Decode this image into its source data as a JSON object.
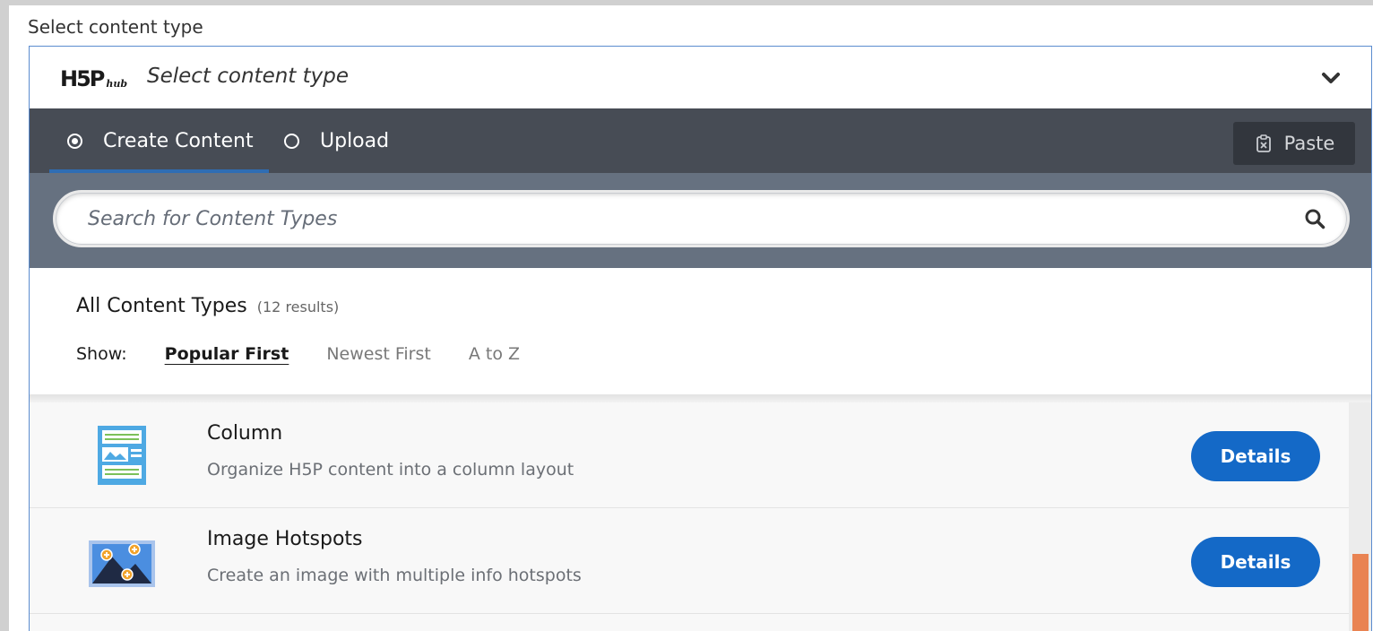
{
  "field_label": "Select content type",
  "header": {
    "logo_main": "H5P",
    "logo_sub": "hub",
    "title": "Select content type"
  },
  "tabs": [
    {
      "label": "Create Content",
      "selected": true
    },
    {
      "label": "Upload",
      "selected": false
    }
  ],
  "paste_button": {
    "label": "Paste"
  },
  "search": {
    "placeholder": "Search for Content Types"
  },
  "results": {
    "title": "All Content Types",
    "count": "(12 results)"
  },
  "sort": {
    "label": "Show:",
    "options": [
      "Popular First",
      "Newest First",
      "A to Z"
    ],
    "active": "Popular First"
  },
  "content_types": [
    {
      "title": "Column",
      "description": "Organize H5P content into a column layout",
      "button": "Details",
      "icon": "column-layout-icon"
    },
    {
      "title": "Image Hotspots",
      "description": "Create an image with multiple info hotspots",
      "button": "Details",
      "icon": "image-hotspots-icon"
    }
  ],
  "colors": {
    "tabbar": "#474c55",
    "searchbar": "#667180",
    "accent": "#1469c7",
    "scroll_thumb": "#e98352"
  }
}
